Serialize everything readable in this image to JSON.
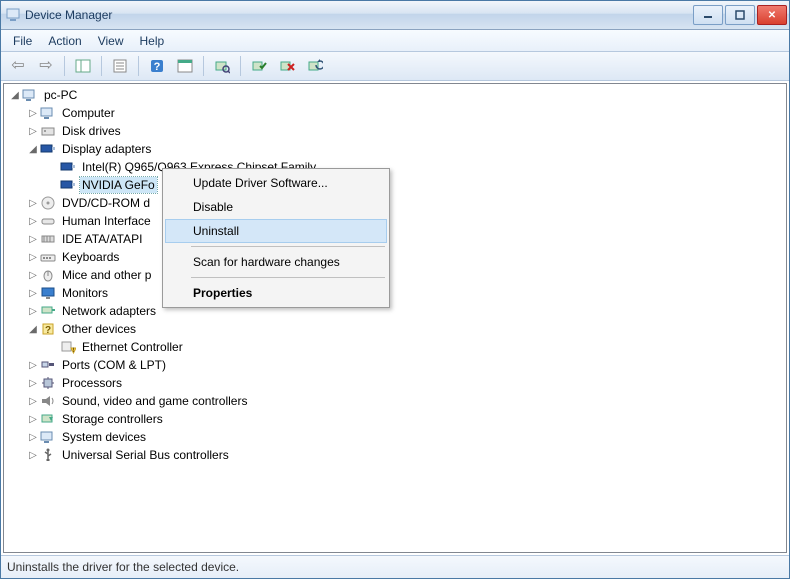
{
  "titlebar": {
    "title": "Device Manager"
  },
  "menubar": [
    "File",
    "Action",
    "View",
    "Help"
  ],
  "tree": {
    "root": "pc-PC",
    "children": [
      {
        "label": "Computer",
        "expanded": false
      },
      {
        "label": "Disk drives",
        "expanded": false
      },
      {
        "label": "Display adapters",
        "expanded": true,
        "children": [
          {
            "label": "Intel(R)  Q965/Q963 Express Chipset Family",
            "leaf": true
          },
          {
            "label": "NVIDIA GeFo",
            "leaf": true,
            "selected": true
          }
        ]
      },
      {
        "label": "DVD/CD-ROM d",
        "expanded": false
      },
      {
        "label": "Human Interface",
        "expanded": false
      },
      {
        "label": "IDE ATA/ATAPI",
        "expanded": false
      },
      {
        "label": "Keyboards",
        "expanded": false
      },
      {
        "label": "Mice and other p",
        "expanded": false
      },
      {
        "label": "Monitors",
        "expanded": false
      },
      {
        "label": "Network adapters",
        "expanded": false
      },
      {
        "label": "Other devices",
        "expanded": true,
        "children": [
          {
            "label": "Ethernet Controller",
            "leaf": true,
            "warn": true
          }
        ]
      },
      {
        "label": "Ports (COM & LPT)",
        "expanded": false
      },
      {
        "label": "Processors",
        "expanded": false
      },
      {
        "label": "Sound, video and game controllers",
        "expanded": false
      },
      {
        "label": "Storage controllers",
        "expanded": false
      },
      {
        "label": "System devices",
        "expanded": false
      },
      {
        "label": "Universal Serial Bus controllers",
        "expanded": false
      }
    ]
  },
  "contextmenu": {
    "items": [
      {
        "label": "Update Driver Software..."
      },
      {
        "label": "Disable"
      },
      {
        "label": "Uninstall",
        "hover": true
      },
      {
        "sep": true
      },
      {
        "label": "Scan for hardware changes"
      },
      {
        "sep": true
      },
      {
        "label": "Properties",
        "bold": true
      }
    ]
  },
  "statusbar": {
    "text": "Uninstalls the driver for the selected device."
  }
}
